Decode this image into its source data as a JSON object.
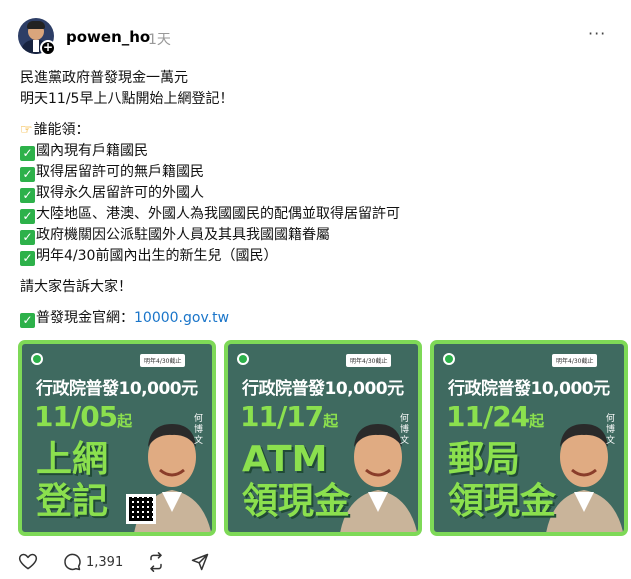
{
  "post": {
    "username": "powen_ho",
    "time": "1天",
    "more_label": "···",
    "lines": [
      "民進黨政府普發現金一萬元",
      "明天11/5早上八點開始上網登記！"
    ],
    "who_header": "誰能領：",
    "eligible": [
      "國內現有戶籍國民",
      "取得居留許可的無戶籍國民",
      "取得永久居留許可的外國人",
      "大陸地區、港澳、外國人為我國國民的配偶並取得居留許可",
      "政府機關因公派駐國外人員及其具我國國籍眷屬",
      "明年4/30前國內出生的新生兒（國民）"
    ],
    "share_line": "請大家告訴大家！",
    "site_label": "普發現金官網：",
    "site_link": "10000.gov.tw"
  },
  "cards": [
    {
      "deadline": "明年4/30截止",
      "headline": "行政院普發10,000元",
      "date": "11/05",
      "date_suffix": "起",
      "big_line1": "上網",
      "big_line2": "登記",
      "name": "何博文",
      "has_qr": true
    },
    {
      "deadline": "明年4/30截止",
      "headline": "行政院普發10,000元",
      "date": "11/17",
      "date_suffix": "起",
      "big_line1": "ATM",
      "big_line2": "領現金",
      "name": "何博文",
      "has_qr": false
    },
    {
      "deadline": "明年4/30截止",
      "headline": "行政院普發10,000元",
      "date": "11/24",
      "date_suffix": "起",
      "big_line1": "郵局",
      "big_line2": "領現金",
      "name": "何博文",
      "has_qr": false
    }
  ],
  "actions": {
    "like_icon": "heart-icon",
    "reply_icon": "comment-icon",
    "reply_count": "1,391",
    "repost_icon": "repost-icon",
    "share_icon": "send-icon"
  },
  "colors": {
    "card_bg": "#3f6a60",
    "card_border": "#7ed957",
    "accent_green": "#8be04e",
    "check_green": "#2db14a",
    "link": "#1a75c9"
  }
}
